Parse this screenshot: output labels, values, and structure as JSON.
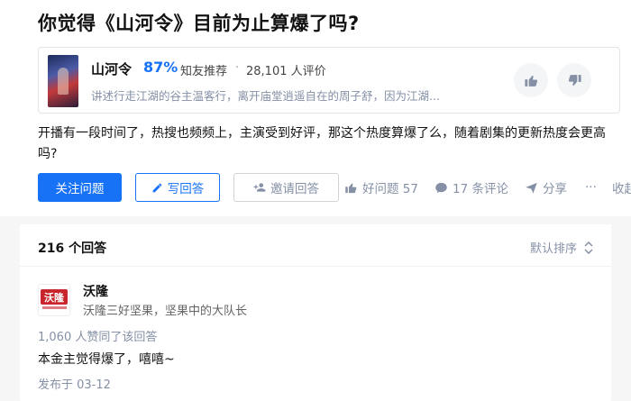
{
  "question": {
    "title": "你觉得《山河令》目前为止算爆了吗?",
    "detail": "开播有一段时间了，热搜也频频上，主演受到好评，那这个热度算爆了么，随着剧集的更新热度会更高吗?"
  },
  "show_card": {
    "name": "山河令",
    "score": "87%",
    "recommend_label": "知友推荐",
    "separator": "·",
    "rating_count": "28,101 人评价",
    "description": "讲述行走江湖的谷主温客行，离开庙堂逍遥自在的周子舒，因为江湖...",
    "poster_icon": "poster-image",
    "upvote_icon": "thumb-up-icon",
    "downvote_icon": "thumb-down-icon"
  },
  "actions": {
    "follow_label": "关注问题",
    "write_label": "写回答",
    "invite_label": "邀请回答",
    "good_question": "好问题 57",
    "comments": "17 条评论",
    "share": "分享",
    "more": "···",
    "collapse": "收起"
  },
  "answers_header": {
    "count": "216 个回答",
    "sort_label": "默认排序"
  },
  "answer": {
    "avatar_text": "沃隆",
    "author": "沃隆",
    "bio": "沃隆三好坚果，坚果中的大队长",
    "agree_text": "1,060 人赞同了该回答",
    "content": "本金主觉得爆了，嘻嘻~",
    "published": "发布于 03-12"
  },
  "colors": {
    "accent": "#1772f6",
    "muted": "#8590a6",
    "brand_red": "#c8252c",
    "page_bg": "#f6f6f6"
  }
}
